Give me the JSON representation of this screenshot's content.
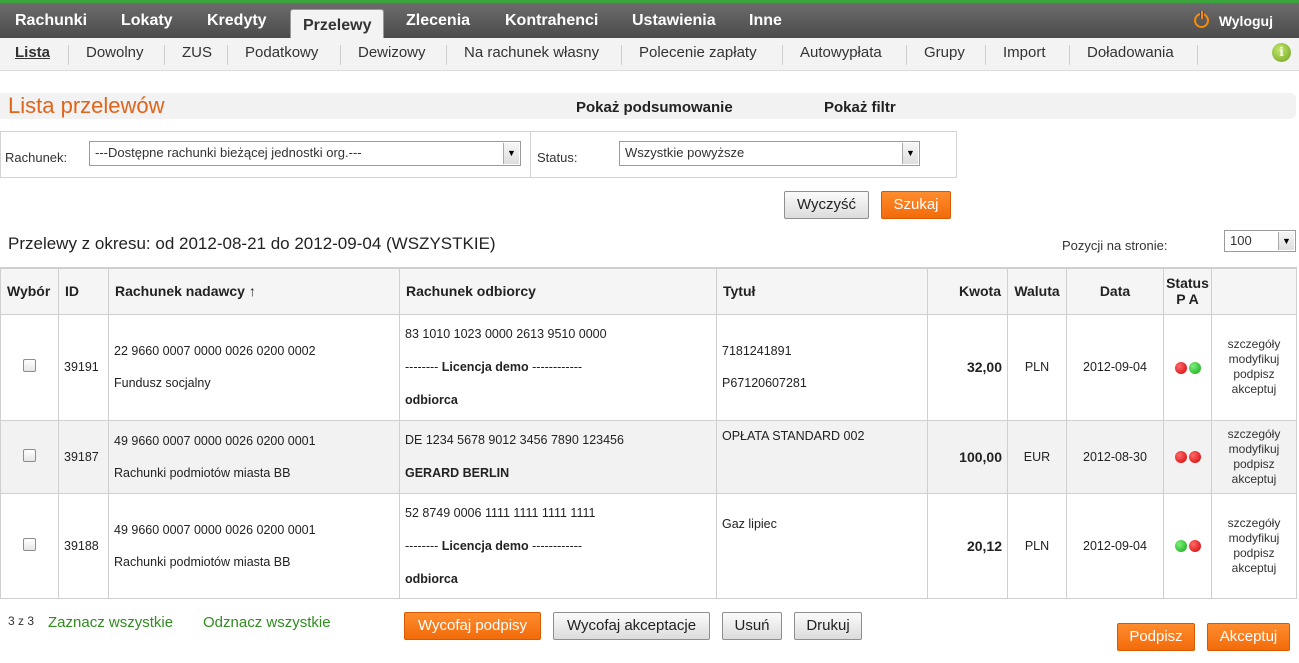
{
  "main_nav": {
    "items": [
      "Rachunki",
      "Lokaty",
      "Kredyty",
      "Przelewy",
      "Zlecenia",
      "Kontrahenci",
      "Ustawienia",
      "Inne"
    ],
    "active": "Przelewy",
    "logout_label": "Wyloguj"
  },
  "sub_nav": {
    "items": [
      "Lista",
      "Dowolny",
      "ZUS",
      "Podatkowy",
      "Dewizowy",
      "Na rachunek własny",
      "Polecenie zapłaty",
      "Autowypłata",
      "Grupy",
      "Import",
      "Doładowania"
    ],
    "active": "Lista",
    "info_icon": "i"
  },
  "page": {
    "title": "Lista przelewów",
    "show_summary": "Pokaż podsumowanie",
    "show_filter": "Pokaż filtr"
  },
  "filter": {
    "account_label": "Rachunek:",
    "account_value": "---Dostępne rachunki bieżącej jednostki org.---",
    "status_label": "Status:",
    "status_value": "Wszystkie powyższe",
    "clear_button": "Wyczyść",
    "search_button": "Szukaj"
  },
  "period_text": "Przelewy z okresu: od 2012-08-21 do 2012-09-04 (WSZYSTKIE)",
  "per_page": {
    "label": "Pozycji na stronie:",
    "value": "100"
  },
  "table": {
    "headers": {
      "select": "Wybór",
      "id": "ID",
      "sender": "Rachunek nadawcy ↑",
      "recipient": "Rachunek odbiorcy",
      "title": "Tytuł",
      "amount": "Kwota",
      "currency": "Waluta",
      "date": "Data",
      "status": "Status",
      "status_sub": "P A"
    },
    "rows": [
      {
        "id": "39191",
        "sender_account": "22 9660 0007 0000 0026 0200 0002",
        "sender_name": "Fundusz socjalny",
        "recipient_account": "83 1010 1023 0000 2613 9510 0000",
        "recipient_line2_prefix": "--------",
        "recipient_line2_bold": "Licencja demo",
        "recipient_line2_suffix": "------------",
        "recipient_line3": "odbiorca",
        "title_line1": "7181241891",
        "title_line2": "P67120607281",
        "amount": "32,00",
        "currency": "PLN",
        "date": "2012-09-04",
        "status_p": "red",
        "status_a": "green",
        "actions": [
          "szczegóły",
          "modyfikuj",
          "podpisz",
          "akceptuj"
        ]
      },
      {
        "id": "39187",
        "sender_account": "49 9660 0007 0000 0026 0200 0001",
        "sender_name": "Rachunki podmiotów miasta BB",
        "recipient_account": "DE 1234 5678 9012 3456 7890 123456",
        "recipient_name": "GERARD BERLIN",
        "title_line1": "OPŁATA STANDARD 002",
        "amount": "100,00",
        "currency": "EUR",
        "date": "2012-08-30",
        "status_p": "red",
        "status_a": "red",
        "actions": [
          "szczegóły",
          "modyfikuj",
          "podpisz",
          "akceptuj"
        ]
      },
      {
        "id": "39188",
        "sender_account": "49 9660 0007 0000 0026 0200 0001",
        "sender_name": "Rachunki podmiotów miasta BB",
        "recipient_account": "52 8749 0006 1111 1111 1111 1111",
        "recipient_line2_prefix": "--------",
        "recipient_line2_bold": "Licencja demo",
        "recipient_line2_suffix": "------------",
        "recipient_line3": "odbiorca",
        "title_line1": "Gaz lipiec",
        "amount": "20,12",
        "currency": "PLN",
        "date": "2012-09-04",
        "status_p": "green",
        "status_a": "red",
        "actions": [
          "szczegóły",
          "modyfikuj",
          "podpisz",
          "akceptuj"
        ]
      }
    ]
  },
  "footer": {
    "count": "3 z 3",
    "select_all": "Zaznacz wszystkie",
    "deselect_all": "Odznacz wszystkie",
    "withdraw_signatures": "Wycofaj podpisy",
    "withdraw_acceptances": "Wycofaj akceptacje",
    "delete": "Usuń",
    "print": "Drukuj",
    "sign": "Podpisz",
    "accept": "Akceptuj"
  },
  "colors": {
    "accent_orange": "#f26b0a",
    "title_orange": "#e0641b",
    "link_green": "#2f8c1f",
    "nav_dark": "#555555",
    "status_red": "#d20000",
    "status_green": "#12a512"
  }
}
